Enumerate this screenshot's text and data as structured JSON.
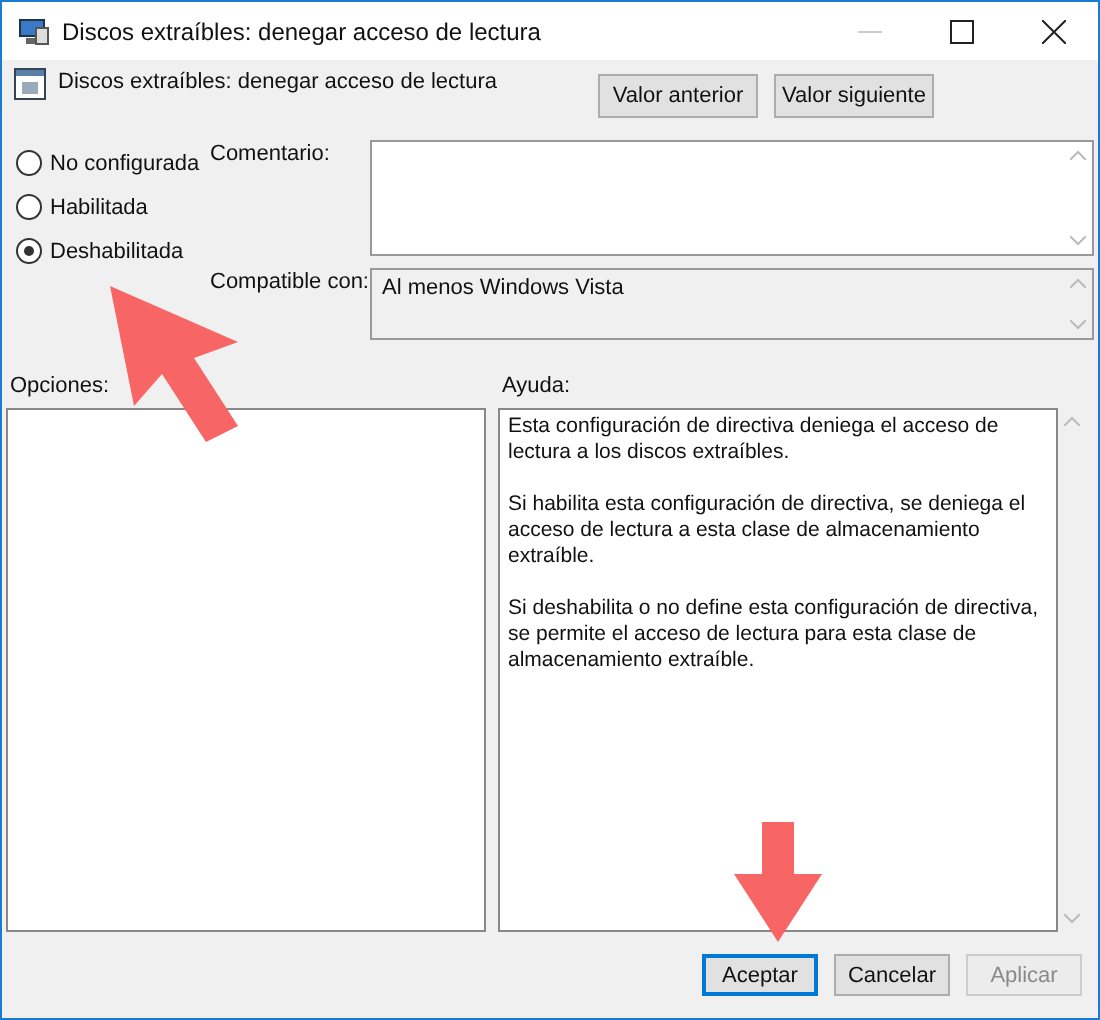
{
  "window": {
    "title": "Discos extraíbles: denegar acceso de lectura"
  },
  "header": {
    "title": "Discos extraíbles: denegar acceso de lectura",
    "buttons": [
      {
        "label": "Valor anterior",
        "disabled": false
      },
      {
        "label": "Valor siguiente",
        "disabled": false
      }
    ]
  },
  "options": [
    {
      "label": "No configurada",
      "selected": false
    },
    {
      "label": "Habilitada",
      "selected": false
    },
    {
      "label": "Deshabilitada",
      "selected": true
    }
  ],
  "comment": {
    "label": "Comentario:"
  },
  "compatible": {
    "label": "Compatible con:",
    "value": "Al menos Windows Vista"
  },
  "options_panel": {
    "label": "Opciones:"
  },
  "help": {
    "label": "Ayuda:",
    "paragraphs": [
      "Esta configuración de directiva deniega el acceso de lectura a los discos extraíbles.",
      "Si habilita esta configuración de directiva, se deniega el acceso de lectura a esta clase de almacenamiento extraíble.",
      "Si deshabilita o no define esta configuración de directiva, se permite el acceso de lectura para esta clase de almacenamiento extraíble."
    ]
  },
  "buttons": [
    {
      "label": "Aceptar",
      "disabled": false,
      "selected": true
    },
    {
      "label": "Cancelar",
      "disabled": false,
      "selected": false
    },
    {
      "label": "Aplicar",
      "disabled": true,
      "selected": false
    }
  ]
}
